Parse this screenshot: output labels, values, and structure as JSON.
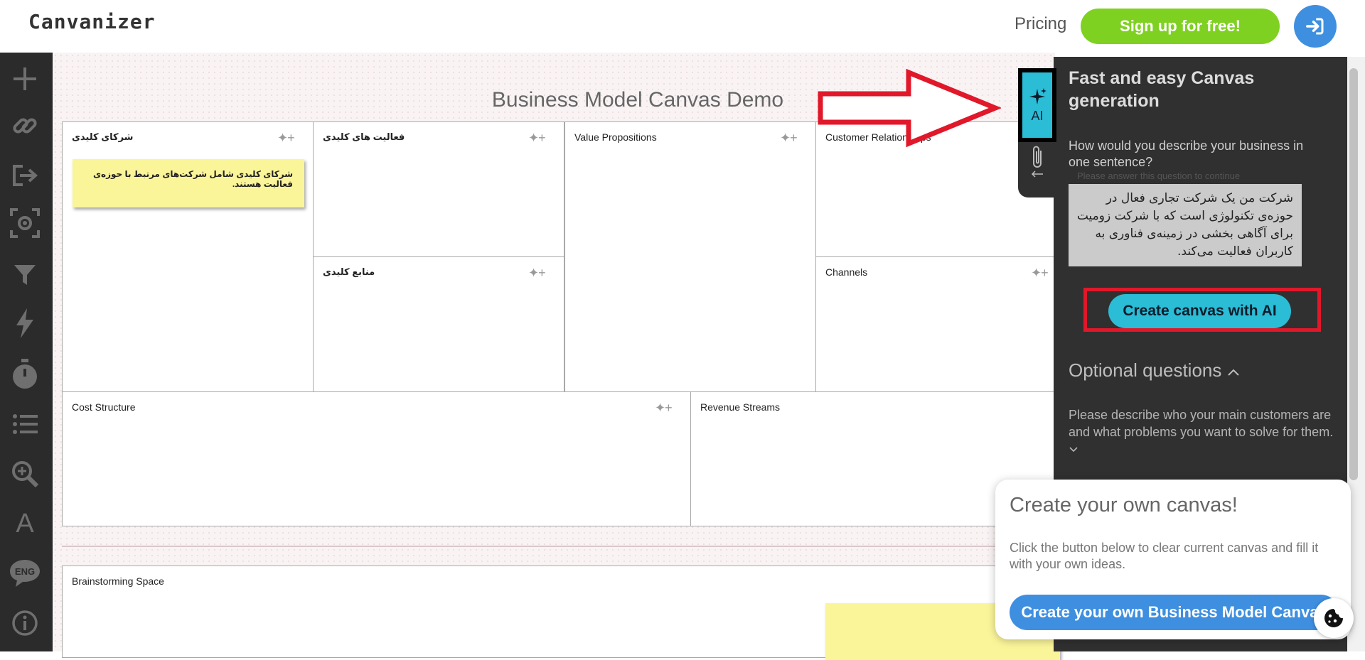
{
  "header": {
    "logo": "Canvanizer",
    "pricing": "Pricing",
    "signup": "Sign up for free!"
  },
  "sidebar": {
    "icons": [
      "add-icon",
      "link-icon",
      "export-icon",
      "focus-icon",
      "filter-icon",
      "lightning-icon",
      "timer-icon",
      "list-icon",
      "zoom-icon",
      "font-icon",
      "language-icon",
      "info-icon"
    ],
    "language": "ENG"
  },
  "canvas": {
    "title": "Business Model Canvas Demo",
    "boxes": {
      "key_partners": "شرکای کلیدی",
      "key_activities": "فعالیت های کلیدی",
      "key_resources": "منابع کلیدی",
      "value_propositions": "Value Propositions",
      "customer_relationships": "Customer Relationships",
      "channels": "Channels",
      "cost_structure": "Cost Structure",
      "revenue_streams": "Revenue Streams",
      "brainstorming": "Brainstorming Space"
    },
    "notes": {
      "partners_note": "شرکای کلیدی شامل شرکت‌های مرتبط با حوزه‌ی فعالیت هستند."
    }
  },
  "ai_panel": {
    "tab_label": "AI",
    "heading": "Fast and easy Canvas generation",
    "question": "How would you describe your business in one sentence?",
    "hint": "Please answer this question to continue",
    "answer": "شرکت من یک شرکت تجاری فعال در حوزه‌ی تکنولوژی است که با شرکت زومیت برای آگاهی بخشی در زمینه‌ی فناوری به کاربران فعالیت می‌کند.",
    "create_button": "Create canvas with AI",
    "optional_heading": "Optional questions",
    "optional_q1": "Please describe who your main customers are and what problems you want to solve for them."
  },
  "popup": {
    "heading": "Create your own canvas!",
    "text": "Click the button below to clear current canvas and fill it with your own ideas.",
    "button": "Create your own Business Model Canvas"
  },
  "colors": {
    "accent_green": "#7fd121",
    "accent_blue": "#3f8fe0",
    "ai_cyan": "#2bbcd6",
    "highlight_red": "#e0182a",
    "sticky_yellow": "#fbf59a"
  }
}
